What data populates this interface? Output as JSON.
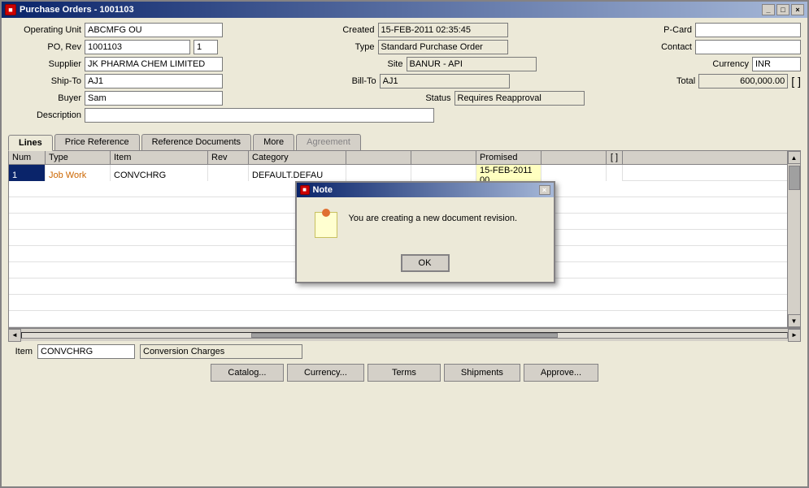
{
  "window": {
    "title": "Purchase Orders - 1001103",
    "close_btn": "×",
    "min_btn": "_",
    "max_btn": "□"
  },
  "form": {
    "operating_unit_label": "Operating Unit",
    "operating_unit_value": "ABCMFG OU",
    "operating_unit_prefix": "ABC",
    "po_rev_label": "PO, Rev",
    "po_rev_value": "1001103",
    "po_rev_num": "1",
    "supplier_label": "Supplier",
    "supplier_value": "JK PHARMA CHEM LIMITED",
    "ship_to_label": "Ship-To",
    "ship_to_value": "AJ1",
    "buyer_label": "Buyer",
    "buyer_value": "Sam",
    "description_label": "Description",
    "description_value": "",
    "created_label": "Created",
    "created_value": "15-FEB-2011 02:35:45",
    "type_label": "Type",
    "type_value": "Standard Purchase Order",
    "site_label": "Site",
    "site_value": "BANUR - API",
    "bill_to_label": "Bill-To",
    "bill_to_value": "AJ1",
    "status_label": "Status",
    "status_value": "Requires Reapproval",
    "pcard_label": "P-Card",
    "pcard_value": "",
    "contact_label": "Contact",
    "contact_value": "",
    "currency_label": "Currency",
    "currency_value": "INR",
    "total_label": "Total",
    "total_value": "600,000.00"
  },
  "tabs": [
    {
      "label": "Lines",
      "active": true,
      "disabled": false
    },
    {
      "label": "Price Reference",
      "active": false,
      "disabled": false
    },
    {
      "label": "Reference Documents",
      "active": false,
      "disabled": false
    },
    {
      "label": "More",
      "active": false,
      "disabled": false
    },
    {
      "label": "Agreement",
      "active": false,
      "disabled": true
    }
  ],
  "table": {
    "columns": [
      {
        "label": "Num",
        "width": 45
      },
      {
        "label": "Type",
        "width": 80
      },
      {
        "label": "Item",
        "width": 120
      },
      {
        "label": "Rev",
        "width": 50
      },
      {
        "label": "Category",
        "width": 120
      },
      {
        "label": "",
        "width": 80
      },
      {
        "label": "",
        "width": 80
      },
      {
        "label": "Promised",
        "width": 80
      },
      {
        "label": "",
        "width": 80
      },
      {
        "label": "[ ]",
        "width": 20
      }
    ],
    "rows": [
      {
        "num": "1",
        "type": "Job Work",
        "item": "CONVCHRG",
        "rev": "",
        "category": "DEFAULT.DEFAU",
        "col6": "",
        "col7": "",
        "promised": "15-FEB-2011 00",
        "col9": "",
        "selected": true
      }
    ],
    "empty_rows": 9
  },
  "bottom": {
    "item_label": "Item",
    "item_value": "CONVCHRG",
    "item_desc": "Conversion Charges"
  },
  "buttons": [
    {
      "label": "Catalog...",
      "name": "catalog-button"
    },
    {
      "label": "Currency...",
      "name": "currency-button"
    },
    {
      "label": "Terms",
      "name": "terms-button"
    },
    {
      "label": "Shipments",
      "name": "shipments-button"
    },
    {
      "label": "Approve...",
      "name": "approve-button"
    }
  ],
  "modal": {
    "title": "Note",
    "message": "You are creating a new document revision.",
    "ok_label": "OK"
  }
}
